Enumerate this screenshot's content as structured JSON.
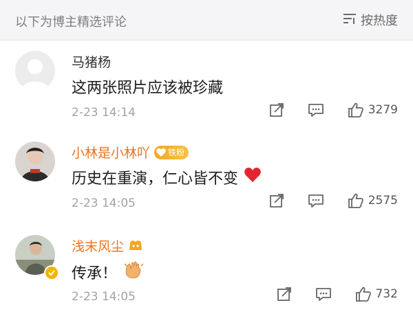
{
  "header": {
    "title": "以下为博主精选评论",
    "sort_label": "按热度",
    "sort_icon": "sort-icon"
  },
  "comments": [
    {
      "name": "马猪杨",
      "text": "这两张照片应该被珍藏",
      "time": "2-23 14:14",
      "likes": "3279",
      "avatar": "default-avatar",
      "name_color": "#333333"
    },
    {
      "name": "小林是小林吖",
      "badge_label": "铁粉",
      "text": "历史在重演，仁心皆不变",
      "emoji": "heart-emoji",
      "time": "2-23 14:05",
      "likes": "2575",
      "avatar": "user-avatar",
      "name_color": "#e8741f"
    },
    {
      "name": "浅末风尘",
      "text": "传承！",
      "emoji": "clapping-hands-emoji",
      "time": "2-23 14:05",
      "likes": "732",
      "avatar": "user-avatar",
      "verified": "verified-badge",
      "name_color": "#e8741f"
    }
  ],
  "colors": {
    "accent_orange": "#e8741f",
    "header_bg": "#f5f5f7",
    "muted_text": "#a3a3a3"
  }
}
